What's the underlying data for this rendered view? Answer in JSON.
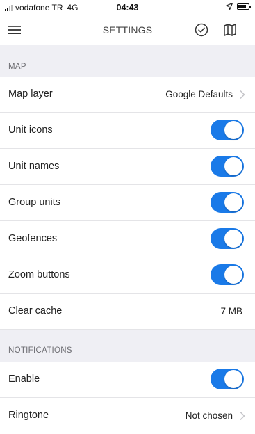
{
  "status_bar": {
    "carrier": "vodafone TR",
    "network": "4G",
    "time": "04:43"
  },
  "nav": {
    "title": "SETTINGS",
    "icons": [
      "menu-icon",
      "check-circle-icon",
      "map-icon"
    ]
  },
  "colors": {
    "accent": "#1a7ae8",
    "background": "#efeff4"
  },
  "sections": {
    "map": {
      "header": "MAP",
      "map_layer": {
        "label": "Map layer",
        "value": "Google Defaults"
      },
      "unit_icons": {
        "label": "Unit icons",
        "on": true
      },
      "unit_names": {
        "label": "Unit names",
        "on": true
      },
      "group_units": {
        "label": "Group units",
        "on": true
      },
      "geofences": {
        "label": "Geofences",
        "on": true
      },
      "zoom_buttons": {
        "label": "Zoom buttons",
        "on": true
      },
      "clear_cache": {
        "label": "Clear cache",
        "value": "7 MB"
      }
    },
    "notifications": {
      "header": "NOTIFICATIONS",
      "enable": {
        "label": "Enable",
        "on": true
      },
      "ringtone": {
        "label": "Ringtone",
        "value": "Not chosen"
      }
    }
  }
}
